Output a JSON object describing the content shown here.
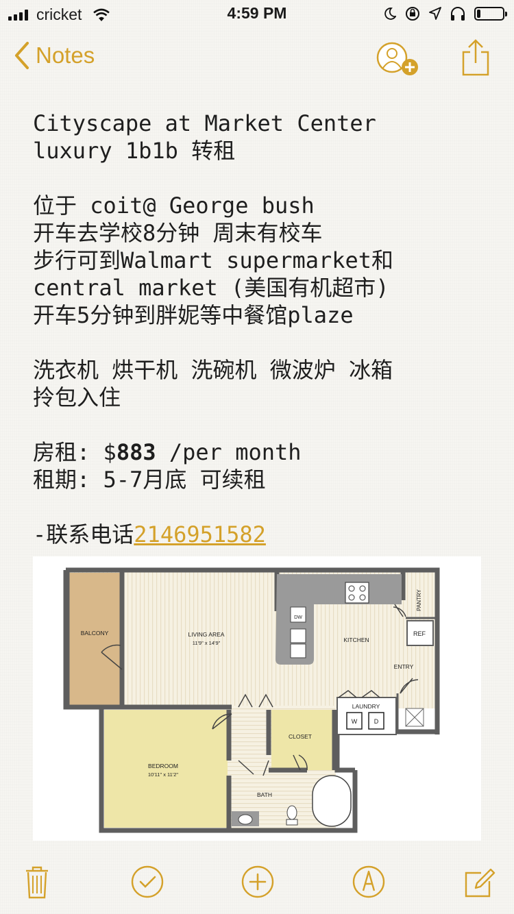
{
  "status_bar": {
    "carrier": "cricket",
    "time": "4:59 PM",
    "icons": [
      "signal-icon",
      "wifi-icon",
      "moon-icon",
      "rotation-lock-icon",
      "location-icon",
      "headphones-icon",
      "battery-icon"
    ],
    "battery_level": 0.15
  },
  "nav": {
    "back_label": "Notes",
    "icons": [
      "chevron-left-icon",
      "add-person-icon",
      "share-icon"
    ],
    "accent": "#d4a12a"
  },
  "note": {
    "title_line1": "Cityscape at Market Center",
    "title_line2": "luxury 1b1b 转租",
    "loc_line1": "位于 coit@ George bush",
    "loc_line2": "开车去学校8分钟 周末有校车",
    "loc_line3": "步行可到Walmart supermarket和",
    "loc_line4": "central market (美国有机超市)",
    "loc_line5": "开车5分钟到胖妮等中餐馆plaze",
    "amen_line1": "洗衣机 烘干机 洗碗机 微波炉 冰箱",
    "amen_line2": "拎包入住",
    "rent_prefix": "房租: $",
    "rent_amount": "883",
    "rent_suffix": " /per month",
    "lease_line": "租期: 5-7月底 可续租",
    "contact_prefix": "-联系电话",
    "contact_phone": "2146951582"
  },
  "floorplan": {
    "balcony": "BALCONY",
    "living_area": "LIVING AREA",
    "living_dims": "11'9\" x 14'9\"",
    "kitchen": "KITCHEN",
    "pantry": "PANTRY",
    "ref": "REF",
    "dw": "DW",
    "entry": "ENTRY",
    "laundry": "LAUNDRY",
    "washer": "W",
    "dryer": "D",
    "closet": "CLOSET",
    "bedroom": "BEDROOM",
    "bedroom_dims": "10'11\" x 11'2\"",
    "bath": "BATH",
    "colors": {
      "wall": "#5e5e5e",
      "balcony": "#d8b88a",
      "bedroom": "#eee6a8",
      "closet": "#eee6a8",
      "floor": "#f5f0e0"
    }
  },
  "toolbar": {
    "icons": [
      "trash-icon",
      "checklist-icon",
      "add-icon",
      "markup-icon",
      "compose-icon"
    ]
  }
}
